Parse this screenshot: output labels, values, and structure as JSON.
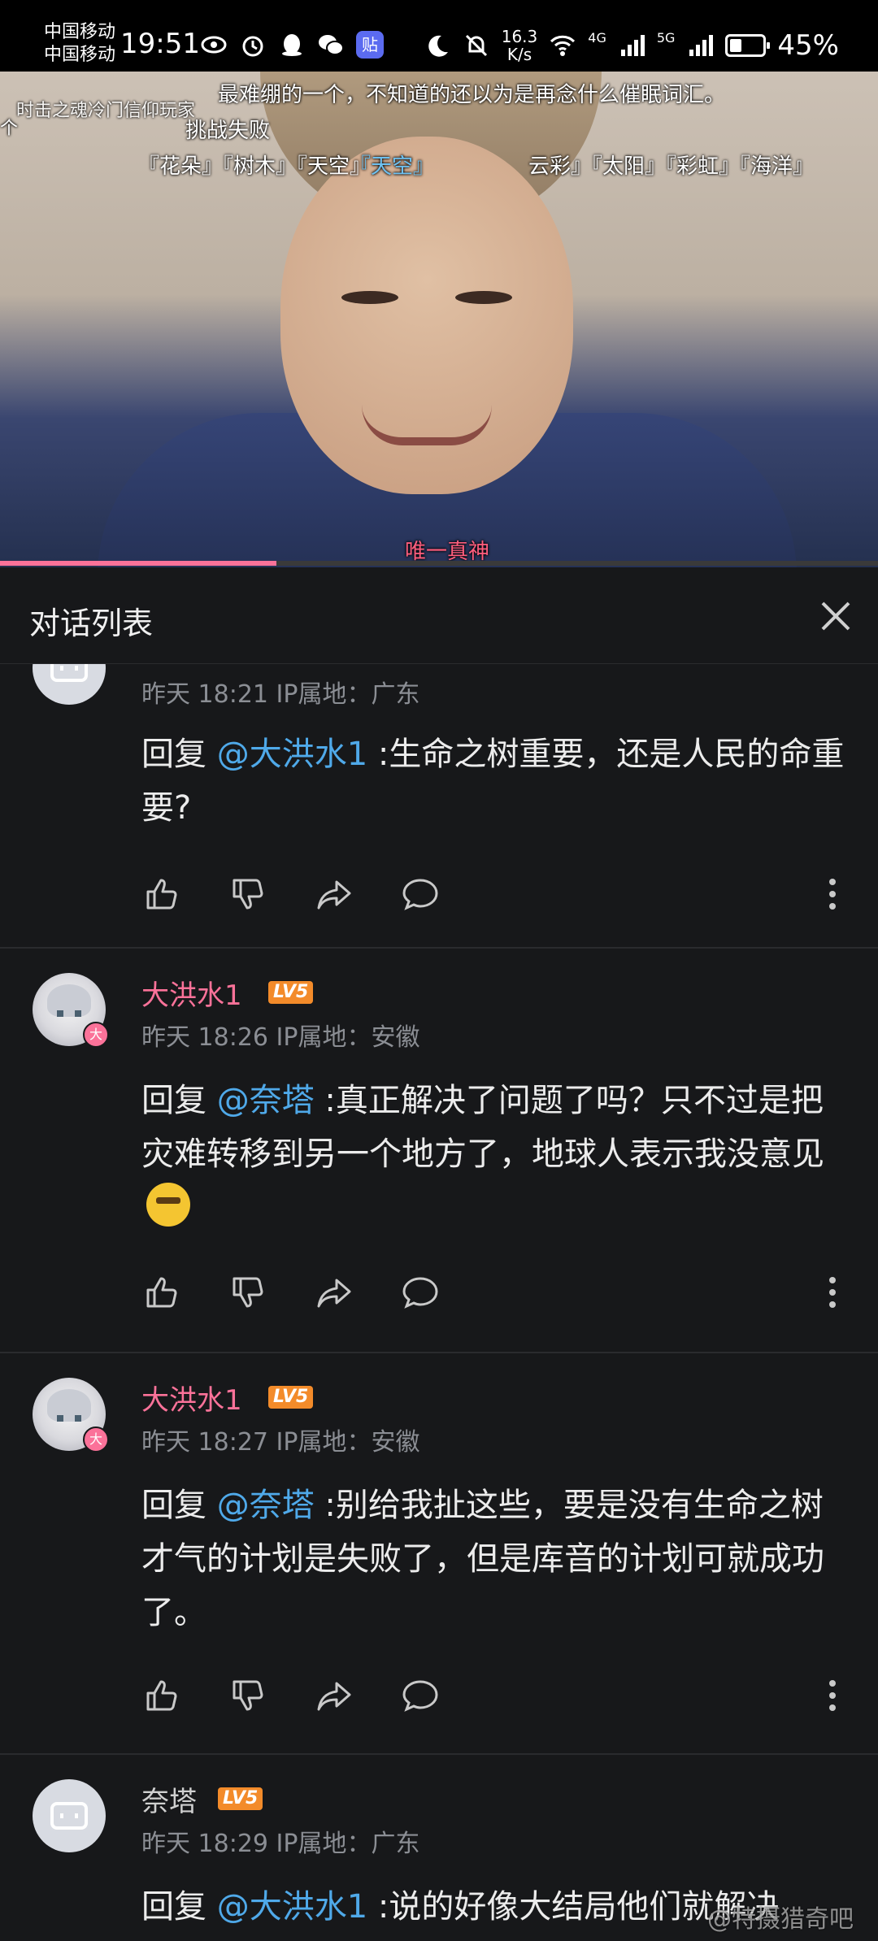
{
  "status_bar": {
    "carrier_1": "中国移动",
    "carrier_2": "中国移动",
    "time": "19:51",
    "app_badge": "贴",
    "net_speed_value": "16.3",
    "net_speed_unit": "K/s",
    "network_4g": "4G",
    "network_5g": "5G",
    "battery_percent": "45%",
    "battery_level": 0.45
  },
  "video": {
    "danmaku": [
      {
        "text": "最难绷的一个，不知道的还以为是再念什么催眠词汇。"
      },
      {
        "text": "时击之魂冷门信仰玩家"
      },
      {
        "text": "个"
      },
      {
        "text": "挑战失败"
      },
      {
        "text": "『花朵』『树木』『天空』"
      },
      {
        "text": "『天空』"
      },
      {
        "text": "云彩』『太阳』『彩虹』『海洋』"
      },
      {
        "text": "唯一真神"
      }
    ],
    "progress": 0.315
  },
  "panel": {
    "title": "对话列表"
  },
  "comments": [
    {
      "user": "",
      "meta": "昨天 18:21 IP属地：广东",
      "reply_prefix": "回复 ",
      "mention": "@大洪水1",
      "text": " :生命之树重要，还是人民的命重要?"
    },
    {
      "user": "大洪水1",
      "level": "LV5",
      "avatar_badge": "大",
      "meta": "昨天 18:26 IP属地：安徽",
      "reply_prefix": "回复 ",
      "mention": "@奈塔",
      "text": " :真正解决了问题了吗？只不过是把灾难转移到另一个地方了，地球人表示我没意见"
    },
    {
      "user": "大洪水1",
      "level": "LV5",
      "avatar_badge": "大",
      "meta": "昨天 18:27 IP属地：安徽",
      "reply_prefix": "回复 ",
      "mention": "@奈塔",
      "text": " :别给我扯这些，要是没有生命之树才气的计划是失败了，但是库音的计划可就成功了。"
    },
    {
      "user": "奈塔",
      "level": "LV5",
      "meta": "昨天 18:29 IP属地：广东",
      "reply_prefix": "回复 ",
      "mention": "@大洪水1",
      "text": " :说的好像大结局他们就解决"
    }
  ],
  "watermark": "@特摄猎奇吧"
}
